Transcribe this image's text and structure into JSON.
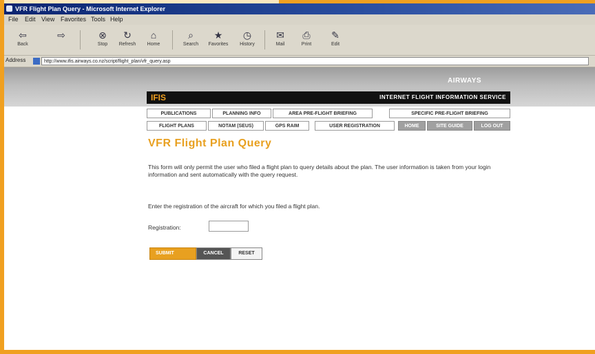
{
  "window": {
    "title": "VFR Flight Plan Query - Microsoft Internet Explorer"
  },
  "menu": [
    "File",
    "Edit",
    "View",
    "Favorites",
    "Tools",
    "Help"
  ],
  "toolbar": {
    "back": "Back",
    "forward": "",
    "stop": "Stop",
    "refresh": "Refresh",
    "home": "Home",
    "search": "Search",
    "favorites": "Favorites",
    "history": "History",
    "mail": "Mail",
    "print": "Print",
    "edit": "Edit"
  },
  "address": {
    "label": "Address",
    "url": "http://www.ifis.airways.co.nz/script/flight_plan/vfr_query.asp"
  },
  "brand": {
    "airways": "AIRWAYS",
    "logo": "IFIS",
    "subtitle": "INTERNET FLIGHT INFORMATION SERVICE"
  },
  "nav": {
    "row1": [
      "PUBLICATIONS",
      "PLANNING INFO",
      "AREA PRE-FLIGHT BRIEFING",
      "SPECIFIC PRE-FLIGHT BRIEFING"
    ],
    "row2": [
      "FLIGHT PLANS",
      "NOTAM (SEUS)",
      "GPS RAIM",
      "USER REGISTRATION",
      "HOME",
      "SITE GUIDE",
      "LOG OUT"
    ]
  },
  "page": {
    "title": "VFR Flight Plan Query",
    "intro": "This form will only permit the user who filed a flight plan to query details about the plan. The user information is taken from your login information and sent automatically with the query request.",
    "instruction": "Enter the registration of the aircraft for which you filed a flight plan.",
    "registration_label": "Registration:",
    "registration_value": ""
  },
  "buttons": {
    "submit": "SUBMIT",
    "cancel": "CANCEL",
    "reset": "RESET"
  },
  "colors": {
    "accent": "#e8a020",
    "frame": "#f0a020",
    "titlebar": "#0a2470"
  }
}
